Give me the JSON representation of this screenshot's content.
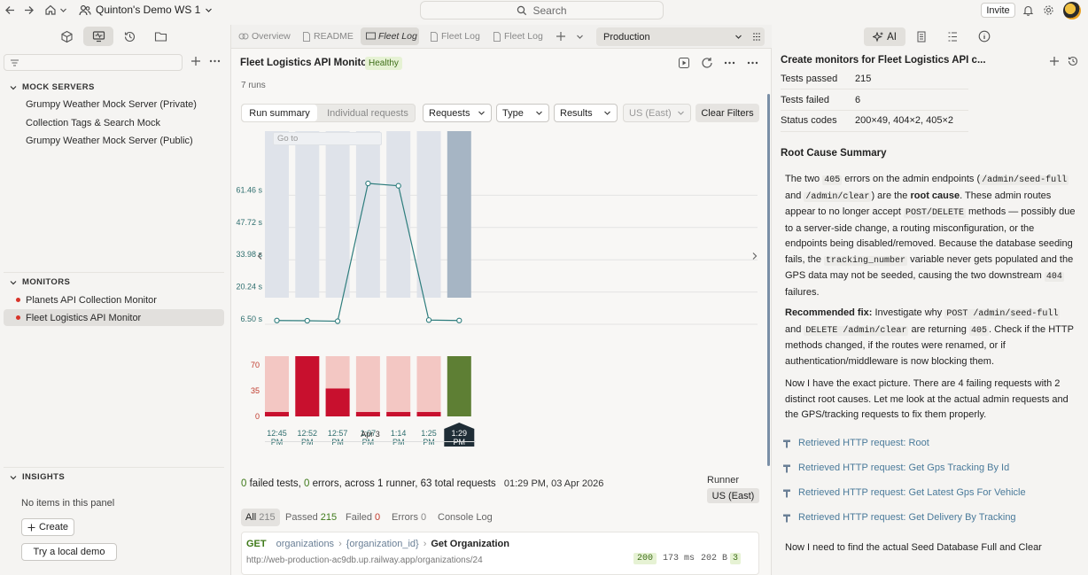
{
  "topbar": {
    "workspace": "Quinton's Demo WS 1",
    "search_placeholder": "Search",
    "invite": "Invite"
  },
  "sidebar": {
    "mock_servers_title": "MOCK SERVERS",
    "mock_servers": [
      "Grumpy Weather Mock Server (Private)",
      "Collection Tags & Search Mock",
      "Grumpy Weather Mock Server (Public)"
    ],
    "monitors_title": "MONITORS",
    "monitors": [
      "Planets API Collection Monitor",
      "Fleet Logistics API Monitor"
    ],
    "insights_title": "INSIGHTS",
    "no_items": "No items in this panel",
    "create": "Create",
    "try_demo": "Try a local demo"
  },
  "tabs": {
    "items": [
      "Overview",
      "README",
      "Fleet Log",
      "Fleet Log",
      "Fleet Log"
    ],
    "environment": "Production"
  },
  "monitor": {
    "title": "Fleet Logistics API Monitor",
    "status": "Healthy",
    "runs": "7 runs",
    "view_tabs": [
      "Run summary",
      "Individual requests"
    ],
    "filters": {
      "requests": "Requests",
      "type": "Type",
      "results": "Results",
      "region": "US (East)",
      "clear": "Clear Filters"
    },
    "goto_placeholder": "Go to",
    "date_label": "Apr 3",
    "summary": {
      "failed": "0",
      "failed_label": " failed tests, ",
      "errors": "0",
      "errors_label": " errors, across 1 runner, 63 total requests",
      "timestamp": "01:29 PM, 03 Apr 2026"
    },
    "runner_label": "Runner",
    "runner_value": "US (East)",
    "result_tabs": {
      "all": "All",
      "all_count": "215",
      "passed": "Passed",
      "passed_count": "215",
      "failed": "Failed",
      "failed_count": "0",
      "errors": "Errors",
      "errors_count": "0",
      "console": "Console Log"
    },
    "request": {
      "method": "GET",
      "path1": "organizations",
      "path2": "{organization_id}",
      "name": "Get Organization",
      "url": "http://web-production-ac9db.up.railway.app/organizations/24",
      "status": "200",
      "time": "173 ms",
      "size": "202 B",
      "count": "3"
    }
  },
  "chart_data": {
    "type": "line",
    "x": [
      "12:45 PM",
      "12:52 PM",
      "12:57 PM",
      "1:07 PM",
      "1:14 PM",
      "1:25 PM",
      "1:29 PM"
    ],
    "series": [
      {
        "values": [
          8.1,
          8.0,
          7.8,
          66.5,
          65.5,
          8.3,
          8.1
        ]
      }
    ],
    "yticks": [
      "6.50 s",
      "20.24 s",
      "33.98 s",
      "47.72 s",
      "61.46 s"
    ],
    "ylim": [
      6.5,
      75.2
    ],
    "bar_chart": {
      "type": "bar",
      "yticks": [
        "0",
        "35",
        "70"
      ],
      "ylim": [
        0,
        82
      ],
      "failed": [
        6,
        82,
        38,
        6,
        6,
        6,
        0
      ],
      "total": [
        82,
        82,
        82,
        82,
        82,
        82,
        82
      ],
      "selected_index": 6
    },
    "colors": {
      "line": "#2e7d7d",
      "failed": "#c8102e",
      "failed_light": "#f3c7c3",
      "passed": "#5e7f34",
      "column": "#dfe3ea",
      "column_selected": "#a6b5c4"
    }
  },
  "ai": {
    "tab": "AI",
    "title": "Create monitors for Fleet Logistics API c...",
    "kv": [
      {
        "k": "Tests passed",
        "v": "215"
      },
      {
        "k": "Tests failed",
        "v": "6"
      },
      {
        "k": "Status codes",
        "v": "200×49, 404×2, 405×2"
      }
    ],
    "heading": "Root Cause Summary",
    "p1": {
      "a": "The two ",
      "c1": "405",
      "b": " errors on the admin endpoints (",
      "c2": "/admin/seed-full",
      "c": " and ",
      "c3": "/admin/clear",
      "d": ") are the ",
      "strong": "root cause",
      "e": ". These admin routes appear to no longer accept ",
      "c4": "POST/DELETE",
      "f": " methods — possibly due to a server-side change, a routing misconfiguration, or the endpoints being disabled/removed. Because the database seeding fails, the ",
      "c5": "tracking_number",
      "g": " variable never gets populated and the GPS data may not be seeded, causing the two downstream ",
      "c6": "404",
      "h": " failures."
    },
    "p2": {
      "strong": "Recommended fix:",
      "a": " Investigate why ",
      "c1": "POST /admin/seed-full",
      "b": " and ",
      "c2": "DELETE /admin/clear",
      "c": " are returning ",
      "c3": "405",
      "d": ". Check if the HTTP methods changed, if the routes were renamed, or if authentication/middleware is now blocking them."
    },
    "p3": "Now I have the exact picture. There are 4 failing requests with 2 distinct root causes. Let me look at the actual admin requests and the GPS/tracking requests to fix them properly.",
    "retrieved": [
      "Retrieved HTTP request: Root",
      "Retrieved HTTP request: Get Gps Tracking By Id",
      "Retrieved HTTP request: Get Latest Gps For Vehicle",
      "Retrieved HTTP request: Get Delivery By Tracking"
    ],
    "p4": "Now I need to find the actual Seed Database Full and Clear"
  }
}
